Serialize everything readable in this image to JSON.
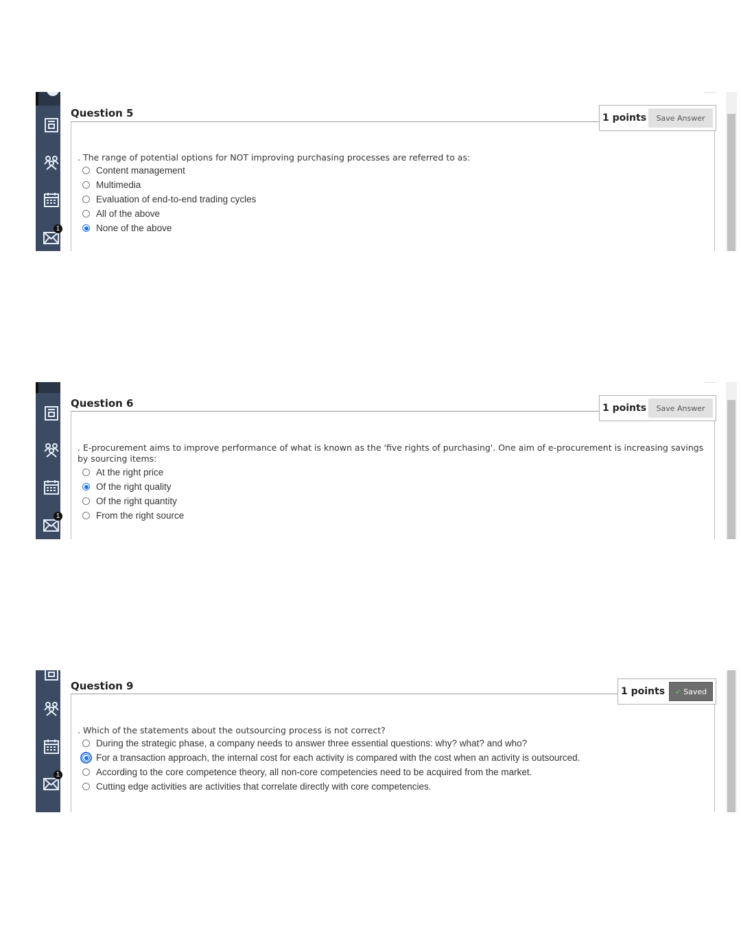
{
  "questions": [
    {
      "title": "Question 5",
      "points": "1 points",
      "button": "Save Answer",
      "saved": false,
      "badge": "1",
      "prompt": ". The range of potential options for NOT improving purchasing processes are referred to as:",
      "options": [
        "Content management",
        "Multimedia",
        "Evaluation of end-to-end trading cycles",
        "All of the above",
        "None of the above"
      ],
      "selected_index": 4
    },
    {
      "title": "Question 6",
      "points": "1 points",
      "button": "Save Answer",
      "saved": false,
      "badge": "1",
      "prompt": ". E-procurement aims to improve performance of what is known as the 'five rights of purchasing'. One aim of e-procurement is increasing savings by sourcing items:",
      "options": [
        "At the right price",
        "Of the right quality",
        "Of the right quantity",
        "From the right source"
      ],
      "selected_index": 1
    },
    {
      "title": "Question 9",
      "points": "1 points",
      "button": "Saved",
      "saved": true,
      "badge": "1",
      "prompt": ". Which of the statements about the outsourcing process is not correct?",
      "options": [
        "During the strategic phase, a company needs to answer three essential questions: why? what? and who?",
        "For a transaction approach, the internal cost for each activity is compared with the cost when an activity is outsourced.",
        "According to the core competence theory, all non-core competencies need to be acquired from the market.",
        "Cutting edge activities are activities that correlate directly with core competencies."
      ],
      "selected_index": 1
    }
  ],
  "icons": [
    "calendar-icon",
    "people-icon",
    "schedule-icon",
    "mail-icon"
  ],
  "colors": {
    "sidebar": "#3b4b63",
    "radio_selected": "#1a73e8",
    "saved_button": "#6d6d6d"
  }
}
